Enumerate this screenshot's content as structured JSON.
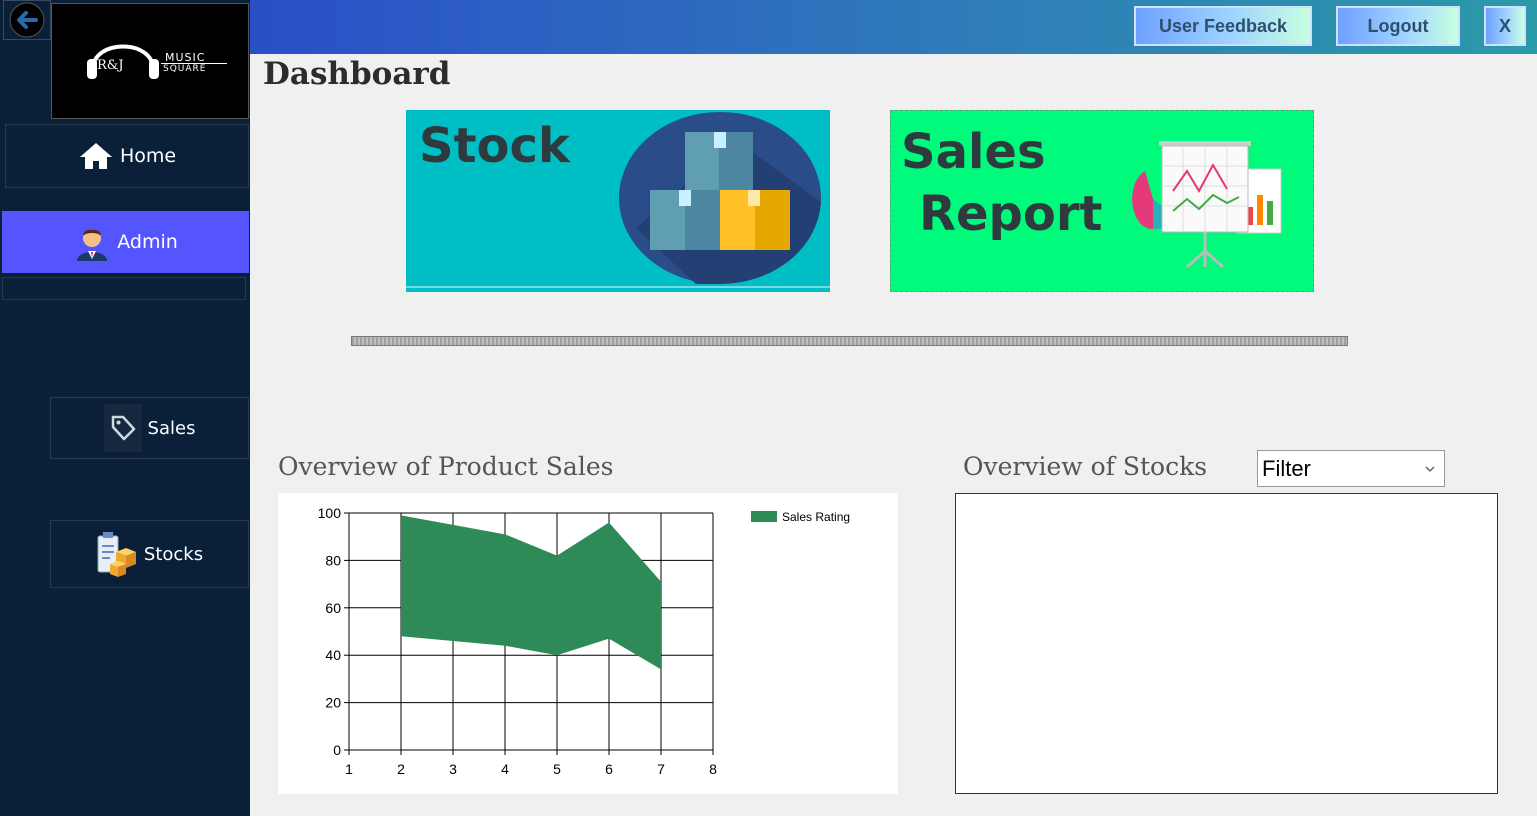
{
  "brand": {
    "initials": "R&J",
    "line1": "MUSIC",
    "line2": "SQUARE"
  },
  "nav": {
    "home": "Home",
    "admin": "Admin",
    "sales": "Sales",
    "stocks": "Stocks"
  },
  "topbar": {
    "feedback": "User Feedback",
    "logout": "Logout",
    "close": "X"
  },
  "page_title": "Dashboard",
  "tiles": {
    "stock": "Stock",
    "sales_line1": "Sales",
    "sales_line2": "Report"
  },
  "sections": {
    "sales_title": "Overview of Product Sales",
    "stocks_title": "Overview of Stocks",
    "filter_value": "Filter"
  },
  "colors": {
    "sidebar": "#0a2038",
    "active_nav": "#5555ff",
    "stock_tile": "#00bfc4",
    "sales_tile": "#00fa7c",
    "series": "#2e8b57"
  },
  "chart_data": {
    "type": "area",
    "x": [
      2,
      3,
      4,
      5,
      6,
      7
    ],
    "series": [
      {
        "name": "Sales Rating",
        "upper": [
          99,
          95,
          91,
          82,
          96,
          71
        ],
        "lower": [
          48,
          46,
          44,
          40,
          47,
          34
        ]
      }
    ],
    "xticks": [
      1,
      2,
      3,
      4,
      5,
      6,
      7,
      8
    ],
    "yticks": [
      0,
      20,
      40,
      60,
      80,
      100
    ],
    "xlim": [
      1,
      8
    ],
    "ylim": [
      0,
      100
    ],
    "grid": true,
    "legend": "top-right"
  }
}
